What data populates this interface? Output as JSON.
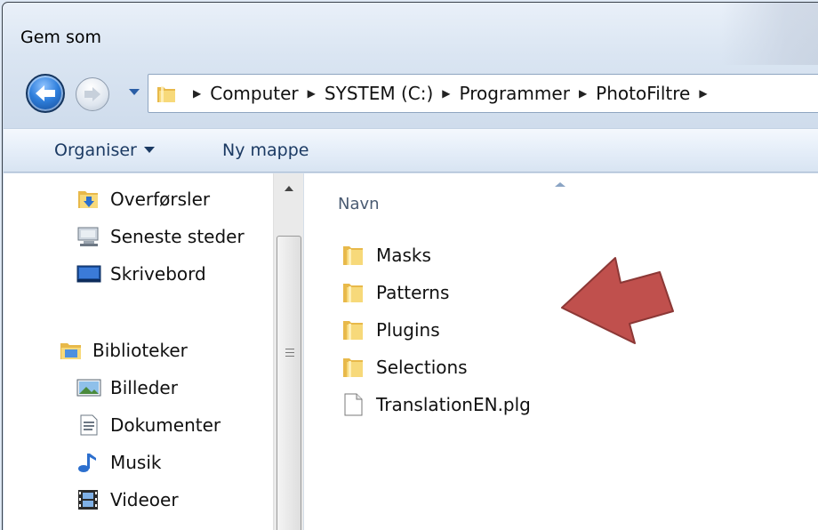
{
  "window": {
    "title": "Gem som"
  },
  "navigation": {
    "path": [
      "Computer",
      "SYSTEM (C:)",
      "Programmer",
      "PhotoFiltre"
    ]
  },
  "toolbar": {
    "organise_label": "Organiser",
    "new_folder_label": "Ny mappe"
  },
  "nav_pane": {
    "favorites": [
      {
        "label": "Overførsler",
        "icon": "downloads-folder-icon"
      },
      {
        "label": "Seneste steder",
        "icon": "recent-places-icon"
      },
      {
        "label": "Skrivebord",
        "icon": "desktop-icon"
      }
    ],
    "libraries_label": "Biblioteker",
    "libraries": [
      {
        "label": "Billeder",
        "icon": "pictures-icon"
      },
      {
        "label": "Dokumenter",
        "icon": "documents-icon"
      },
      {
        "label": "Musik",
        "icon": "music-icon"
      },
      {
        "label": "Videoer",
        "icon": "videos-icon"
      }
    ]
  },
  "file_list": {
    "column_name": "Navn",
    "items": [
      {
        "name": "Masks",
        "type": "folder"
      },
      {
        "name": "Patterns",
        "type": "folder"
      },
      {
        "name": "Plugins",
        "type": "folder"
      },
      {
        "name": "Selections",
        "type": "folder"
      },
      {
        "name": "TranslationEN.plg",
        "type": "file"
      }
    ]
  },
  "colors": {
    "callout_arrow": "#c0504d",
    "callout_arrow_border": "#8c3836",
    "folder_yellow": "#f2cf66"
  }
}
